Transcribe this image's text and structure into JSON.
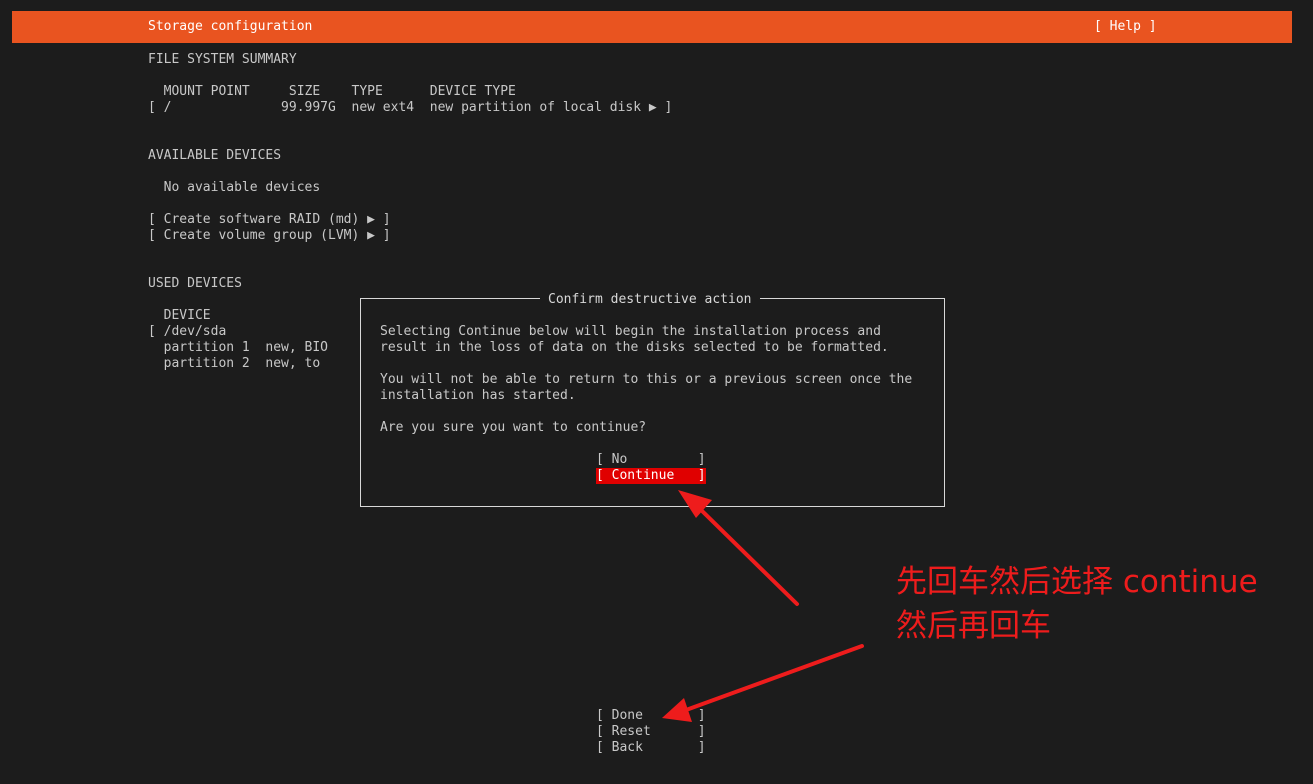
{
  "header": {
    "title": "Storage configuration",
    "help": "[ Help ]"
  },
  "fs_summary": {
    "heading": "FILE SYSTEM SUMMARY",
    "columns": "  MOUNT POINT     SIZE    TYPE      DEVICE TYPE",
    "rows": [
      "[ /              99.997G  new ext4  new partition of local disk ▶ ]"
    ]
  },
  "available": {
    "heading": "AVAILABLE DEVICES",
    "empty": "  No available devices",
    "actions": [
      "[ Create software RAID (md) ▶ ]",
      "[ Create volume group (LVM) ▶ ]"
    ]
  },
  "used": {
    "heading": "USED DEVICES",
    "columns": "  DEVICE",
    "rows": [
      "[ /dev/sda",
      "  partition 1  new, BIO",
      "  partition 2  new, to"
    ]
  },
  "dialog": {
    "title": "Confirm destructive action",
    "para1": [
      "Selecting Continue below will begin the installation process and",
      "result in the loss of data on the disks selected to be formatted."
    ],
    "para2": [
      "You will not be able to return to this or a previous screen once the",
      "installation has started."
    ],
    "question": "Are you sure you want to continue?",
    "buttons": {
      "no": "[ No         ]",
      "continue": "[ Continue   ]"
    }
  },
  "footer": {
    "done": "[ Done       ]",
    "reset": "[ Reset      ]",
    "back": "[ Back       ]"
  },
  "annotation": {
    "line1": "先回车然后选择 continue",
    "line2": "然后再回车"
  },
  "colors": {
    "accent": "#e95420",
    "selected": "#e00000",
    "annotation": "#ee1c1c",
    "background": "#1c1c1c"
  }
}
